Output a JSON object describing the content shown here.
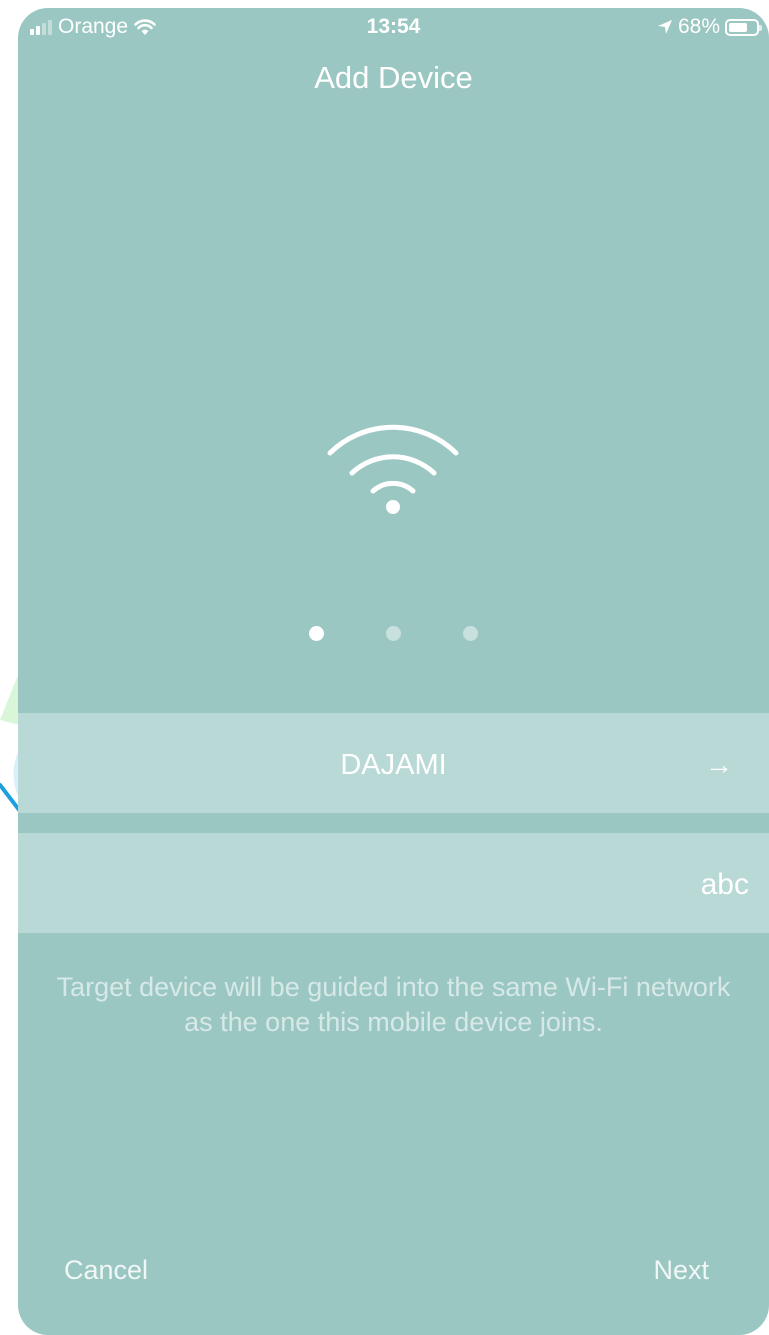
{
  "status_bar": {
    "carrier": "Orange",
    "time": "13:54",
    "battery": "68%",
    "battery_level": 0.68
  },
  "header": {
    "title": "Add Device"
  },
  "illustration": {
    "icon": "wifi-icon"
  },
  "pager": {
    "total": 3,
    "active_index": 0
  },
  "wifi_network": {
    "ssid": "DAJAMI",
    "action_icon": "→"
  },
  "password_field": {
    "value": "abc",
    "placeholder": ""
  },
  "description": "Target device will be guided into the same Wi-Fi network as the one this mobile device joins.",
  "footer": {
    "cancel_label": "Cancel",
    "next_label": "Next"
  },
  "colors": {
    "background": "#9bc7c3",
    "field_background": "#b8d9d6",
    "text": "#ffffff",
    "annotation_arrow": "#1aa0dc"
  }
}
